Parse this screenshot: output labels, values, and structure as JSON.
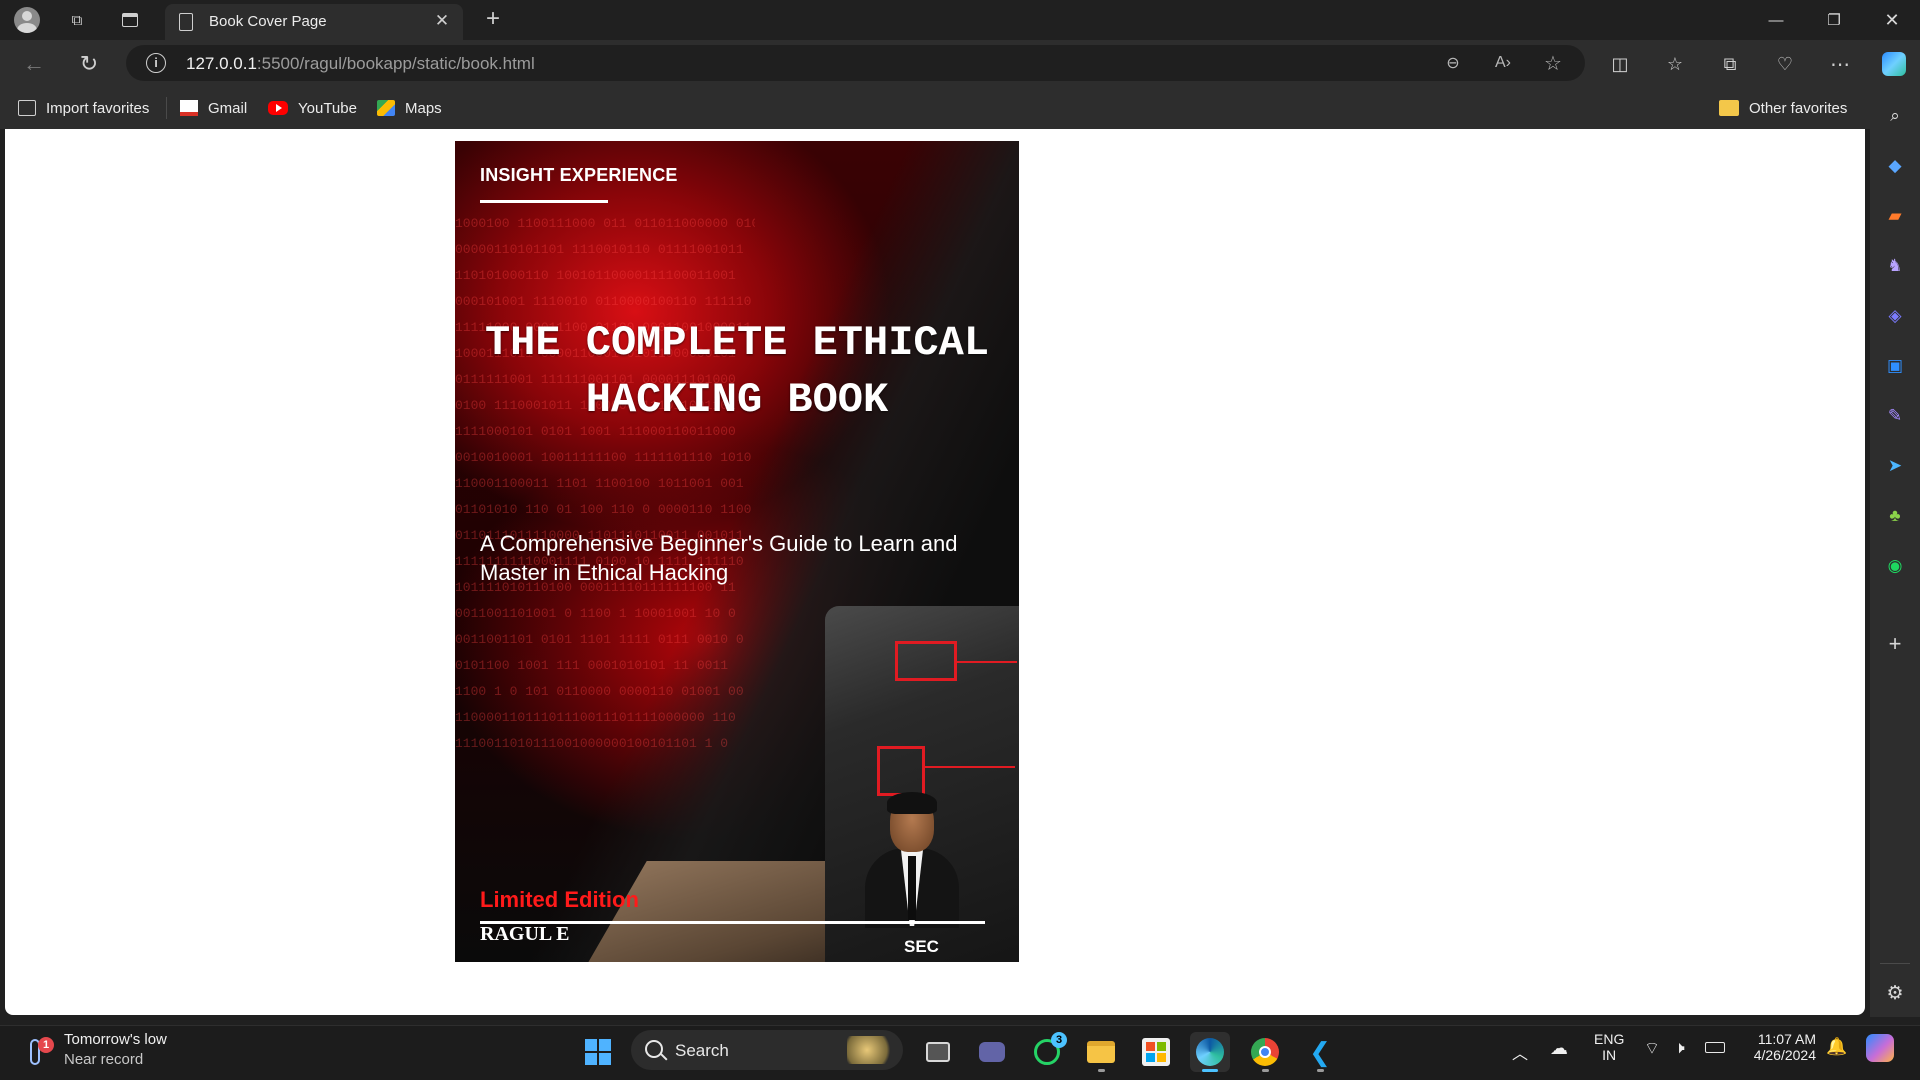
{
  "browser": {
    "tab_title": "Book Cover Page",
    "url_host": "127.0.0.1",
    "url_rest": ":5500/ragul/bookapp/static/book.html",
    "favorites": [
      {
        "label": "Import favorites",
        "icon": "import-favorites-icon"
      },
      {
        "label": "Gmail",
        "icon": "gmail-icon"
      },
      {
        "label": "YouTube",
        "icon": "youtube-icon"
      },
      {
        "label": "Maps",
        "icon": "maps-icon"
      }
    ],
    "other_favorites": "Other favorites"
  },
  "cover": {
    "series": "INSIGHT EXPERIENCE",
    "title": "THE COMPLETE ETHICAL HACKING BOOK",
    "subtitle": "A Comprehensive Beginner's Guide to Learn and Master in Ethical Hacking",
    "edition": "Limited Edition",
    "author": "RAGUL E",
    "org": "SEC",
    "accent_color": "#ff1a1a",
    "code_text": "1000100 1100111000 011 011011000000 0100\n00000110101101 1110010110 01111001011\n110101000110 10010110000111100011001\n000101001 1110010 0110000100110 111110\n11111000 00011100 01100 00011001000011\n1000111011 0000110001 01011000000101\n0111111001 111111001101 000011101000\n0100 1110001011 1000000 111011001101\n1111000101 0101 1001 111000110011000\n0010010001 10011111100 1111101110 1010\n110001100011 1101 1100100 1011001 001\n01101010 110 01 100 110 0 0000110 1100\n0110111011110000 1101110110011 001011\n11111111110001111 0100 10 1111 111110\n101111010110100 00011110111111100 11\n0011001101001 0 1100 1 10001001 10 0\n0011001101 0101 1101 1111 0111 0010 0\n0101100 1001 111 0001010101 11 0011\n1100 1 0 101 0110000 0000110 01001 00\n11000011011101110011101111000000 110\n1110011010111001000000100101101 1 0"
  },
  "taskbar": {
    "weather_title": "Tomorrow's low",
    "weather_sub": "Near record",
    "weather_badge": "1",
    "search_label": "Search",
    "whatsapp_badge": "3",
    "lang_top": "ENG",
    "lang_bottom": "IN",
    "time": "11:07 AM",
    "date": "4/26/2024"
  }
}
